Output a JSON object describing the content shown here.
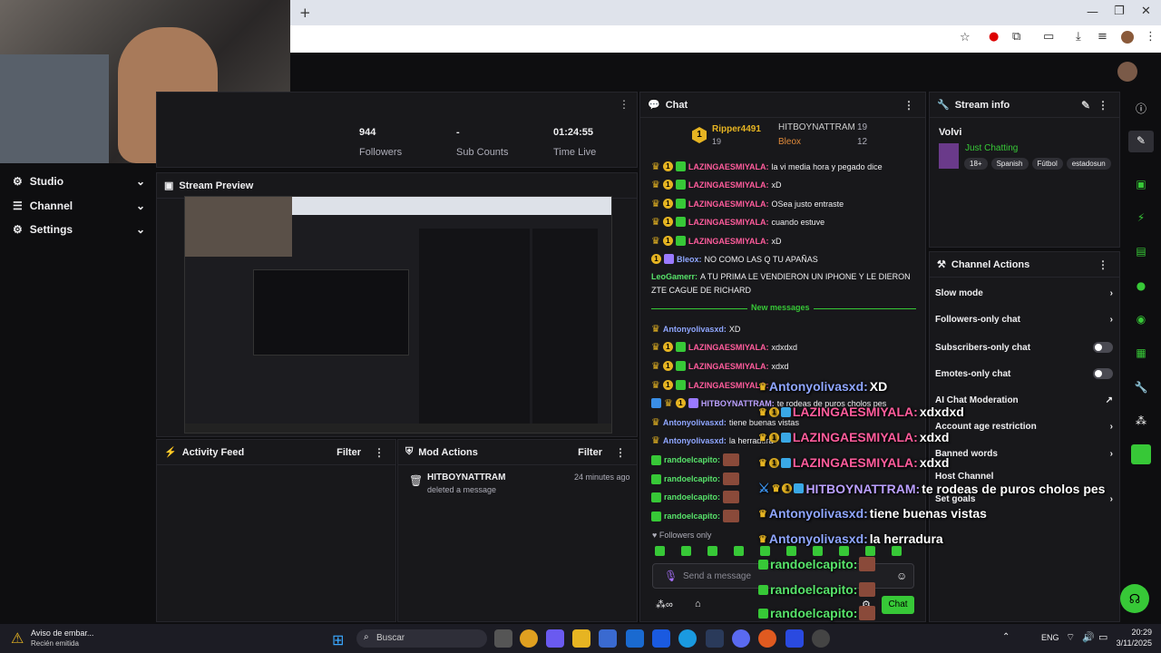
{
  "browser": {
    "new_tab": "+"
  },
  "app": {
    "sidebar": [
      {
        "label": "Studio"
      },
      {
        "label": "Channel"
      },
      {
        "label": "Settings"
      }
    ],
    "stats": [
      {
        "value": "944",
        "label": "Followers"
      },
      {
        "value": "-",
        "label": "Sub Counts"
      },
      {
        "value": "01:24:55",
        "label": "Time Live"
      }
    ],
    "stream_preview": {
      "title": "Stream Preview"
    },
    "activity_feed": {
      "title": "Activity Feed",
      "filter": "Filter"
    },
    "mod_actions": {
      "title": "Mod Actions",
      "filter": "Filter",
      "entries": [
        {
          "user": "HITBOYNATTRAM",
          "action": "deleted a message",
          "time": "24 minutes ago"
        }
      ]
    },
    "chat": {
      "title": "Chat",
      "leaderboard": [
        {
          "rank": "1",
          "name": "Ripper4491",
          "count": "19"
        },
        {
          "name": "HITBOYNATTRAM",
          "count": "19"
        },
        {
          "name": "Bleox",
          "count": "12"
        }
      ],
      "messages": [
        {
          "user": "LAZINGAESMIYALA:",
          "text": "la vi media hora y pegado dice"
        },
        {
          "user": "LAZINGAESMIYALA:",
          "text": "xD"
        },
        {
          "user": "LAZINGAESMIYALA:",
          "text": "OSea justo entraste"
        },
        {
          "user": "LAZINGAESMIYALA:",
          "text": "cuando estuve"
        },
        {
          "user": "LAZINGAESMIYALA:",
          "text": "xD"
        },
        {
          "user": "Bleox:",
          "text": "NO COMO LAS Q TU APAÑAS"
        },
        {
          "user": "LeoGamerr:",
          "text": "A TU PRIMA LE VENDIERON UN IPHONE Y LE DIERON"
        },
        {
          "user": "",
          "text": "ZTE CAGUE DE RICHARD"
        }
      ],
      "new_messages": "New messages",
      "messages2": [
        {
          "user": "Antonyolivasxd:",
          "text": "XD"
        },
        {
          "user": "LAZINGAESMIYALA:",
          "text": "xdxdxd"
        },
        {
          "user": "LAZINGAESMIYALA:",
          "text": "xdxd"
        },
        {
          "user": "LAZINGAESMIYALA:",
          "text": "xdxd"
        },
        {
          "user": "HITBOYNATTRAM:",
          "text": "te rodeas de puros cholos pes"
        },
        {
          "user": "Antonyolivasxd:",
          "text": "tiene buenas vistas"
        },
        {
          "user": "Antonyolivasxd:",
          "text": "la herradura"
        },
        {
          "user": "randoelcapito:",
          "text": ""
        },
        {
          "user": "randoelcapito:",
          "text": ""
        },
        {
          "user": "randoelcapito:",
          "text": ""
        },
        {
          "user": "randoelcapito:",
          "text": ""
        }
      ],
      "followers_only": "Followers only",
      "placeholder": "Send a message",
      "send": "Chat"
    },
    "stream_info": {
      "title": "Stream info",
      "stream_title": "Volvi",
      "category": "Just Chatting",
      "tags": [
        "18+",
        "Spanish",
        "Fútbol",
        "estadosun"
      ]
    },
    "channel_actions": {
      "title": "Channel Actions",
      "items": [
        "Slow mode",
        "Followers-only chat",
        "Subscribers-only chat",
        "Emotes-only chat",
        "AI Chat Moderation",
        "Account age restriction",
        "Banned words",
        "Host Channel",
        "Set goals"
      ]
    }
  },
  "overlay": [
    {
      "user": "Antonyolivasxd:",
      "text": "XD"
    },
    {
      "user": "LAZINGAESMIYALA:",
      "text": "xdxdxd"
    },
    {
      "user": "LAZINGAESMIYALA:",
      "text": "xdxd"
    },
    {
      "user": "LAZINGAESMIYALA:",
      "text": "xdxd"
    },
    {
      "user": "HITBOYNATTRAM:",
      "text": "te rodeas de puros cholos pes"
    },
    {
      "user": "Antonyolivasxd:",
      "text": "tiene buenas vistas"
    },
    {
      "user": "Antonyolivasxd:",
      "text": "la herradura"
    },
    {
      "user": "randoelcapito:",
      "text": ""
    },
    {
      "user": "randoelcapito:",
      "text": ""
    },
    {
      "user": "randoelcapito:",
      "text": ""
    }
  ],
  "taskbar": {
    "notification_title": "Aviso de embar...",
    "notification_sub": "Recién emitida",
    "search": "Buscar",
    "lang": "ENG",
    "time": "20:29",
    "date": "3/11/2025"
  }
}
